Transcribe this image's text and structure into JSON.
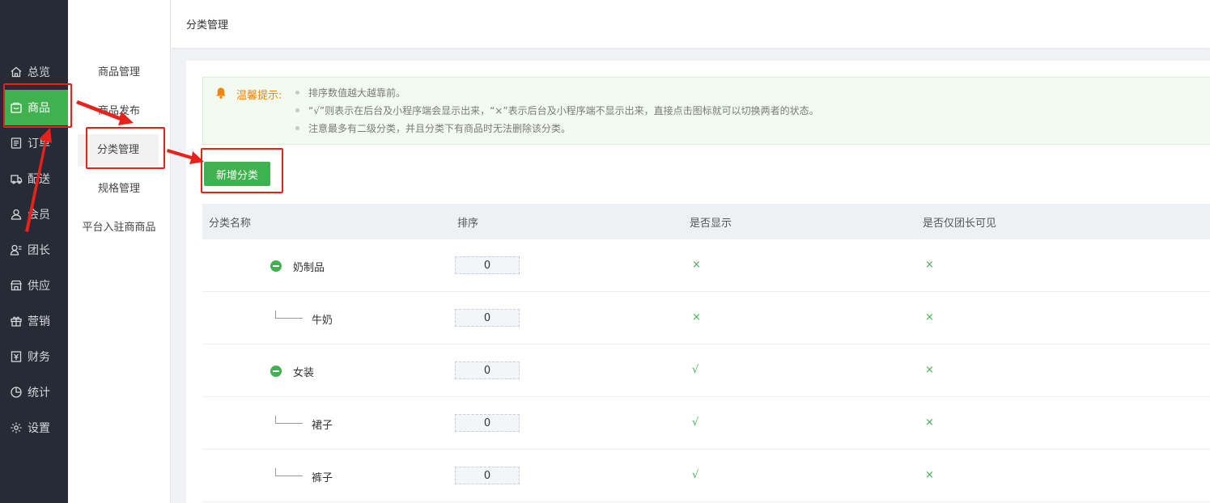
{
  "nav": {
    "items": [
      {
        "label": "总览",
        "icon": "home-icon"
      },
      {
        "label": "商品",
        "icon": "goods-icon",
        "active": true
      },
      {
        "label": "订单",
        "icon": "order-icon"
      },
      {
        "label": "配送",
        "icon": "delivery-icon"
      },
      {
        "label": "会员",
        "icon": "member-icon"
      },
      {
        "label": "团长",
        "icon": "leader-icon"
      },
      {
        "label": "供应",
        "icon": "supply-icon"
      },
      {
        "label": "营销",
        "icon": "gift-icon"
      },
      {
        "label": "财务",
        "icon": "finance-icon"
      },
      {
        "label": "统计",
        "icon": "stats-icon"
      },
      {
        "label": "设置",
        "icon": "gear-icon"
      }
    ]
  },
  "subnav": {
    "items": [
      {
        "label": "商品管理"
      },
      {
        "label": "商品发布"
      },
      {
        "label": "分类管理",
        "active": true
      },
      {
        "label": "规格管理"
      },
      {
        "label": "平台入驻商商品"
      }
    ]
  },
  "header": {
    "title": "分类管理"
  },
  "tip": {
    "label": "温馨提示:",
    "lines": [
      "排序数值越大越靠前。",
      "“√”则表示在后台及小程序端会显示出来，“×”表示后台及小程序端不显示出来，直接点击图标就可以切换两者的状态。",
      "注意最多有二级分类，并且分类下有商品时无法删除该分类。"
    ]
  },
  "add_button": "新增分类",
  "table": {
    "headers": [
      "分类名称",
      "排序",
      "是否显示",
      "是否仅团长可见"
    ],
    "rows": [
      {
        "name": "奶制品",
        "level": 1,
        "sort": "0",
        "show": "×",
        "leader_only": "×"
      },
      {
        "name": "牛奶",
        "level": 2,
        "sort": "0",
        "show": "×",
        "leader_only": "×"
      },
      {
        "name": "女装",
        "level": 1,
        "sort": "0",
        "show": "√",
        "leader_only": "×"
      },
      {
        "name": "裙子",
        "level": 2,
        "sort": "0",
        "show": "√",
        "leader_only": "×"
      },
      {
        "name": "裤子",
        "level": 2,
        "sort": "0",
        "show": "√",
        "leader_only": "×"
      }
    ]
  },
  "colors": {
    "accent": "#3fb24f",
    "sidebar": "#272b36",
    "warning": "#f0860c",
    "annotation": "#e8211b"
  }
}
